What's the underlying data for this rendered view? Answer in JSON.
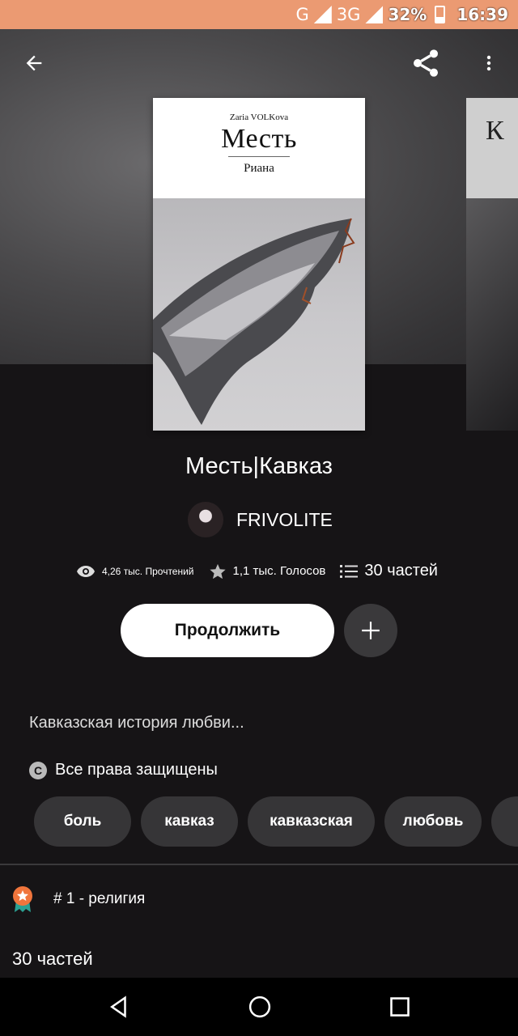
{
  "status_bar": {
    "network1": "G",
    "network2": "3G",
    "network2_sup": "3G",
    "battery": "32%",
    "time": "16:39"
  },
  "cover": {
    "author": "Zaria VOLKova",
    "title": "Месть",
    "subtitle": "Риана"
  },
  "next_cover": {
    "letter": "К"
  },
  "story": {
    "title": "Месть|Кавказ",
    "author": "FRIVOLITE",
    "reads": "4,26 тыс. Прочтений",
    "votes": "1,1 тыс. Голосов",
    "parts": "30 частей"
  },
  "actions": {
    "continue_label": "Продолжить"
  },
  "description": "Кавказская история любви...",
  "rights": "Все права защищены",
  "tags": [
    "боль",
    "кавказ",
    "кавказская",
    "любовь"
  ],
  "rank": "# 1 - религия",
  "parts_heading": "30 частей",
  "colors": {
    "status_bar": "#eb9a72",
    "background": "#161416",
    "button_primary": "#ffffff",
    "tag_bg": "#363537",
    "rank_badge": "#f0753c",
    "rank_ribbon": "#2aa092"
  },
  "icons": [
    "back-arrow-icon",
    "share-icon",
    "more-vert-icon",
    "eye-icon",
    "star-icon",
    "list-icon",
    "plus-icon",
    "copyright-icon",
    "award-badge-icon",
    "nav-back-icon",
    "nav-home-icon",
    "nav-recents-icon"
  ]
}
